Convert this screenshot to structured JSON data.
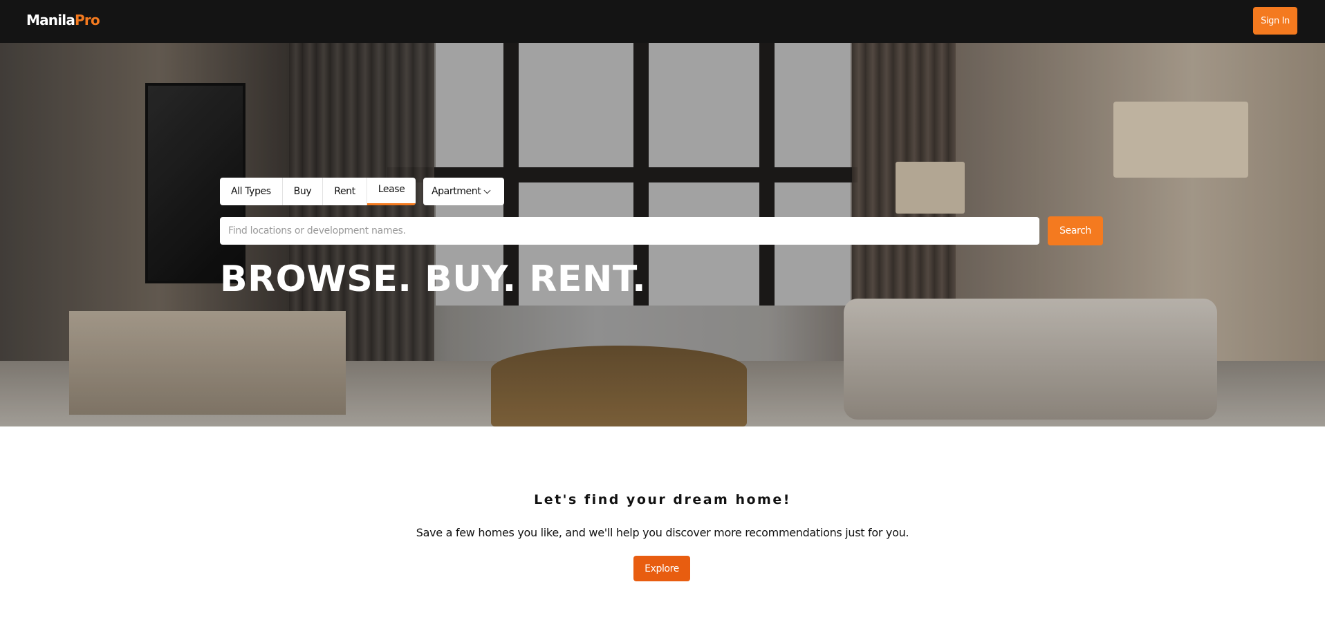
{
  "header": {
    "logo_main": "Manila",
    "logo_accent": "Pro",
    "signin_label": "Sign In"
  },
  "search": {
    "tabs": [
      {
        "label": "All Types"
      },
      {
        "label": "Buy"
      },
      {
        "label": "Rent"
      },
      {
        "label": "Lease",
        "active": true
      }
    ],
    "property_type": "Apartment",
    "placeholder": "Find locations or development names.",
    "button_label": "Search"
  },
  "hero": {
    "headline": "BROWSE. BUY. RENT."
  },
  "cta": {
    "title": "Let's find your dream home!",
    "subtitle": "Save a few homes you like, and we'll help you discover more recommendations just for you.",
    "button_label": "Explore"
  },
  "colors": {
    "accent": "#f47a1f",
    "topbar": "#141414"
  }
}
